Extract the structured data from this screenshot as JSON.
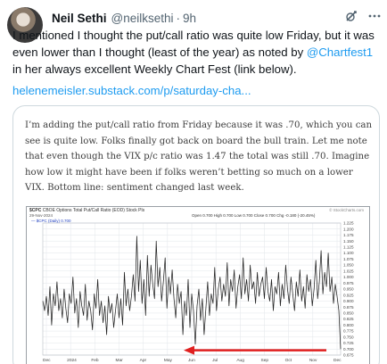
{
  "tweet": {
    "author_name": "Neil Sethi",
    "author_handle": "@neilksethi",
    "separator": "·",
    "time": "9h",
    "text_before_mention": "I mentioned I thought the put/call ratio was quite low Friday, but it was even lower than I thought (least of the year) as noted by ",
    "mention": "@Chartfest1",
    "text_after_mention": " in her always excellent Weekly Chart Fest (link below).",
    "link": "helenemeisler.substack.com/p/saturday-cha..."
  },
  "icons": {
    "avatar": "avatar-image",
    "grok": "grok-icon",
    "more": "more-icon"
  },
  "card": {
    "quote": "I’m adding the put/call ratio from Friday because it was .70, which you can see is quite low. Folks finally got back on board the bull train. Let me note that even though the VIX p/c ratio was 1.47 the total was still .70. Imagine how low it might have been if folks weren’t betting so much on a lower VIX. Bottom line: sentiment changed last week."
  },
  "chart": {
    "symbol": "$CPC",
    "description": "CBOE Options Total Put/Call Ratio (EOD) Stock Pls",
    "date": "29-Nov-2024",
    "watermark": "© StockCharts.com",
    "ohlc": "Open 0.700  High 0.700  Low 0.700  Close 0.700  Chg -0.180 (-20.45%)",
    "legend": "— $CPC (Daily) 0.700",
    "x_labels": [
      "Dec",
      "2024",
      "Feb",
      "Mar",
      "Apr",
      "May",
      "Jun",
      "Jul",
      "Aug",
      "Sep",
      "Oct",
      "Nov",
      "Dec"
    ],
    "y_labels": [
      "1.225",
      "1.200",
      "1.175",
      "1.150",
      "1.125",
      "1.100",
      "1.075",
      "1.050",
      "1.025",
      "1.000",
      "0.975",
      "0.950",
      "0.925",
      "0.900",
      "0.875",
      "0.850",
      "0.825",
      "0.800",
      "0.775",
      "0.750",
      "0.725",
      "0.700",
      "0.675"
    ],
    "colors": {
      "line": "#222222",
      "arrow": "#e02020",
      "grid": "#e2e6ea"
    }
  },
  "chart_data": {
    "type": "line",
    "title": "$CPC CBOE Options Total Put/Call Ratio (EOD) Stock Pls",
    "ylim": [
      0.675,
      1.225
    ],
    "grid": true,
    "series": [
      {
        "name": "$CPC (Daily)",
        "values": [
          0.9,
          0.86,
          0.92,
          0.84,
          0.96,
          0.8,
          0.93,
          0.88,
          0.98,
          0.86,
          0.91,
          0.83,
          0.95,
          0.87,
          0.81,
          0.93,
          0.89,
          1.0,
          0.85,
          0.91,
          0.79,
          0.94,
          0.88,
          0.84,
          0.97,
          0.82,
          0.9,
          0.86,
          0.78,
          0.93,
          0.87,
          0.99,
          0.84,
          0.9,
          0.81,
          0.88,
          0.76,
          0.92,
          0.85,
          0.89,
          0.79,
          0.86,
          0.93,
          0.83,
          0.91,
          0.8,
          1.02,
          0.88,
          0.95,
          0.86,
          0.92,
          1.01,
          0.9,
          1.17,
          0.94,
          1.07,
          0.89,
          0.99,
          0.84,
          1.09,
          0.92,
          1.05,
          0.97,
          0.91,
          1.15,
          0.96,
          1.04,
          0.9,
          0.98,
          1.08,
          0.87,
          1.0,
          0.93,
          1.03,
          0.91,
          0.83,
          0.97,
          0.89,
          0.94,
          0.76,
          0.9,
          0.84,
          0.99,
          0.79,
          0.93,
          0.86,
          0.72,
          0.88,
          0.95,
          0.82,
          0.91,
          0.76,
          0.87,
          0.98,
          0.84,
          0.93,
          0.89,
          1.04,
          0.86,
          0.95,
          1.0,
          0.9,
          0.97,
          0.92,
          1.06,
          0.88,
          0.99,
          0.94,
          1.03,
          0.87,
          0.96,
          1.01,
          0.91,
          1.08,
          0.93,
          0.99,
          0.9,
          1.05,
          0.95,
          0.98,
          0.89,
          1.02,
          0.92,
          0.97,
          1.0,
          0.91,
          1.04,
          0.94,
          0.9,
          0.99,
          0.86,
          0.96,
          0.93,
          1.02,
          0.88,
          0.97,
          0.91,
          1.05,
          0.95,
          0.89,
          1.0,
          0.93,
          0.86,
          0.98,
          0.92,
          1.03,
          0.9,
          0.96,
          0.87,
          1.01,
          0.94,
          0.99,
          0.88,
          0.95,
          1.07,
          0.91,
          0.98,
          1.11,
          0.93,
          1.02,
          0.96,
          1.1,
          0.94,
          1.0,
          0.89,
          0.97,
          0.92,
          0.86,
          0.7
        ]
      }
    ],
    "annotations": [
      "red arrow pointing left"
    ]
  }
}
